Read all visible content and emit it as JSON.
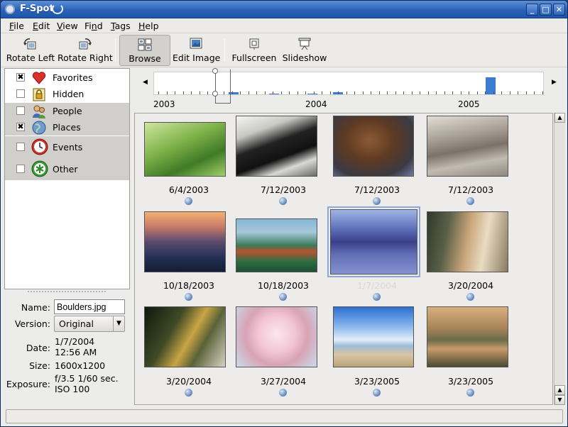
{
  "window": {
    "title": "F-Spot"
  },
  "menu": [
    {
      "label": "File",
      "key": "F"
    },
    {
      "label": "Edit",
      "key": "E"
    },
    {
      "label": "View",
      "key": "V"
    },
    {
      "label": "Find",
      "key": "n"
    },
    {
      "label": "Tags",
      "key": "T"
    },
    {
      "label": "Help",
      "key": "H"
    }
  ],
  "toolbar": {
    "rotate_left": "Rotate Left",
    "rotate_right": "Rotate Right",
    "browse": "Browse",
    "edit_image": "Edit Image",
    "fullscreen": "Fullscreen",
    "slideshow": "Slideshow"
  },
  "tags": [
    {
      "label": "Favorites",
      "checked": true,
      "icon": "heart-icon"
    },
    {
      "label": "Hidden",
      "checked": false,
      "icon": "lock-icon"
    },
    {
      "label": "People",
      "checked": false,
      "icon": "people-icon"
    },
    {
      "label": "Places",
      "checked": true,
      "icon": "globe-icon"
    },
    {
      "label": "Events",
      "checked": false,
      "icon": "clock-icon"
    },
    {
      "label": "Other",
      "checked": false,
      "icon": "asterisk-icon"
    }
  ],
  "info": {
    "name_label": "Name:",
    "name_value": "Boulders.jpg",
    "version_label": "Version:",
    "version_value": "Original",
    "date_label": "Date:",
    "date_value": "1/7/2004",
    "time_value": "12:56 AM",
    "size_label": "Size:",
    "size_value": "1600x1200",
    "exposure_label": "Exposure:",
    "exposure_value": "f/3.5 1/60 sec.",
    "iso_value": "ISO 100"
  },
  "timeline": {
    "years": [
      "2003",
      "2004",
      "2005"
    ]
  },
  "photos": [
    {
      "date": "6/4/2003",
      "thumb": "green-leaf"
    },
    {
      "date": "7/12/2003",
      "thumb": "colobus-monkey"
    },
    {
      "date": "7/12/2003",
      "thumb": "brown-bear"
    },
    {
      "date": "7/12/2003",
      "thumb": "sea-lions"
    },
    {
      "date": "10/18/2003",
      "thumb": "sunset-mountains"
    },
    {
      "date": "10/18/2003",
      "thumb": "green-hills"
    },
    {
      "date": "1/7/2004",
      "thumb": "boulders-beach"
    },
    {
      "date": "3/20/2004",
      "thumb": "wolf"
    },
    {
      "date": "3/20/2004",
      "thumb": "turtle"
    },
    {
      "date": "3/27/2004",
      "thumb": "cherry-blossoms"
    },
    {
      "date": "3/23/2005",
      "thumb": "blue-sky-beach"
    },
    {
      "date": "3/23/2005",
      "thumb": "dusk-lake"
    }
  ]
}
